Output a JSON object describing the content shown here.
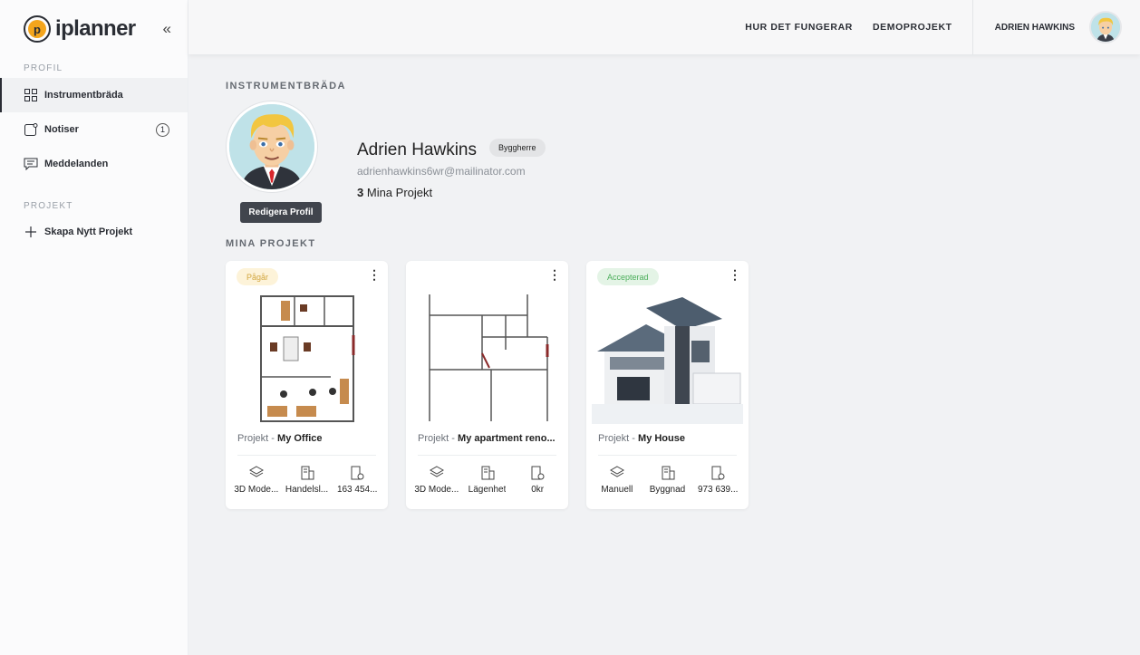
{
  "app": {
    "logo_text": "iplanner",
    "collapse_icon": "chevrons-left-icon"
  },
  "sidebar": {
    "profile_label": "PROFIL",
    "items": [
      {
        "label": "Instrumentbräda",
        "icon": "dashboard-grid-icon",
        "active": true
      },
      {
        "label": "Notiser",
        "icon": "notification-icon",
        "badge": "1"
      },
      {
        "label": "Meddelanden",
        "icon": "chat-icon"
      }
    ],
    "project_label": "PROJEKT",
    "new_project": {
      "label": "Skapa Nytt Projekt",
      "icon": "plus-icon"
    }
  },
  "topbar": {
    "links": [
      "HUR DET FUNGERAR",
      "DEMOPROJEKT"
    ],
    "user_name": "ADRIEN HAWKINS"
  },
  "dashboard": {
    "title": "INSTRUMENTBRÄDA",
    "edit_button": "Redigera Profil",
    "name": "Adrien Hawkins",
    "role": "Byggherre",
    "email": "adrienhawkins6wr@mailinator.com",
    "project_count": "3",
    "project_count_label": "Mina Projekt",
    "projects_title": "MINA PROJEKT"
  },
  "projects": [
    {
      "status": "Pågår",
      "status_colors": {
        "bg": "#fdf3d9",
        "fg": "#d2a63f"
      },
      "prefix": "Projekt -",
      "name": "My Office",
      "meta": [
        "3D Mode...",
        "Handelsl...",
        "163 454..."
      ]
    },
    {
      "status": "",
      "prefix": "Projekt -",
      "name": "My apartment reno...",
      "meta": [
        "3D Mode...",
        "Lägenhet",
        "0kr"
      ]
    },
    {
      "status": "Accepterad",
      "status_colors": {
        "bg": "#e4f4e6",
        "fg": "#4cae5b"
      },
      "prefix": "Projekt -",
      "name": "My House",
      "meta": [
        "Manuell",
        "Byggnad",
        "973 639..."
      ]
    }
  ]
}
